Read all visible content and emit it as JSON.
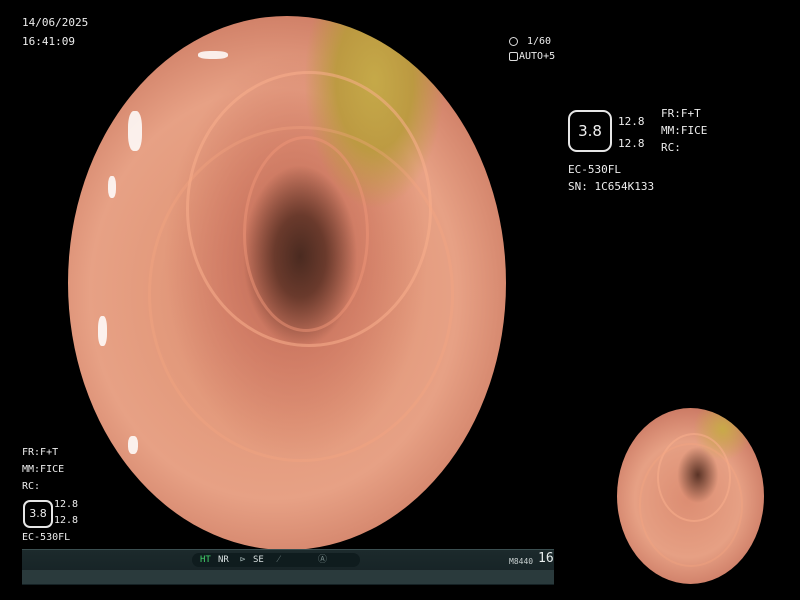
{
  "datetime": {
    "date": "14/06/2025",
    "time": "16:41:09"
  },
  "shutter": {
    "speed": "1/60",
    "auto": "AUTO+5",
    "speed_icon": "shutter-icon",
    "auto_icon": "auto-iris-icon"
  },
  "settings_main": {
    "badge_value": "3.8",
    "value_top": "12.8",
    "value_bottom": "12.8",
    "fr": "FR:F+T",
    "mm": "MM:FICE",
    "rc": "RC:",
    "scope": "EC-530FL",
    "serial": "SN: 1C654K133"
  },
  "settings_small": {
    "fr": "FR:F+T",
    "mm": "MM:FICE",
    "rc": "RC:",
    "badge_value": "3.8",
    "value_top": "12.8",
    "value_bottom": "12.8",
    "scope": "EC-530FL"
  },
  "status_bar": {
    "ht": "HT",
    "nr": "NR",
    "se": "SE",
    "se_icon": "se-icon",
    "slash_icon": "slash-icon",
    "circle_icon": "circle-a-icon",
    "model": "M8440",
    "number": "16",
    "colors": {
      "ht": "#43d36b",
      "text": "#d8e0e0"
    }
  }
}
